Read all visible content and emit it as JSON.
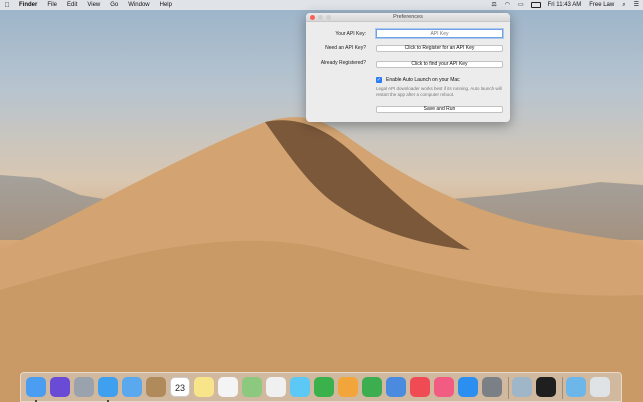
{
  "menubar": {
    "apple": "",
    "app": "Finder",
    "items": [
      "File",
      "Edit",
      "View",
      "Go",
      "Window",
      "Help"
    ],
    "clock": "Fri 11:43 AM",
    "user": "Free Law"
  },
  "window": {
    "title": "Preferences",
    "api_key_label": "Your API Key:",
    "api_key_value": "",
    "api_key_placeholder": "API Key",
    "need_key_label": "Need an API Key?",
    "register_button": "Click to Register for an API Key",
    "registered_label": "Already Registered?",
    "find_key_button": "Click to find your API Key",
    "auto_launch_label": "Enable Auto Launch on your Mac",
    "auto_launch_checked": true,
    "help_text": "Legal API downloader works best if its running. Auto launch will restart the app after a computer reboot.",
    "save_button": "Save and Run"
  },
  "dock": {
    "calendar_day": "23",
    "apps": [
      {
        "name": "finder-icon",
        "color": "#4a9df0"
      },
      {
        "name": "siri-icon",
        "color": "#6a4bd6"
      },
      {
        "name": "launchpad-icon",
        "color": "#9aa3ad"
      },
      {
        "name": "safari-icon",
        "color": "#3fa0f0"
      },
      {
        "name": "mail-icon",
        "color": "#5aa9ee"
      },
      {
        "name": "contacts-icon",
        "color": "#b08a5a"
      },
      {
        "name": "calendar-icon",
        "color": "#ffffff"
      },
      {
        "name": "notes-icon",
        "color": "#f8e58a"
      },
      {
        "name": "reminders-icon",
        "color": "#f4f4f4"
      },
      {
        "name": "maps-icon",
        "color": "#8cc97e"
      },
      {
        "name": "photos-icon",
        "color": "#f0f0f0"
      },
      {
        "name": "messages-icon",
        "color": "#5cc8f5"
      },
      {
        "name": "facetime-icon",
        "color": "#3ab14a"
      },
      {
        "name": "pages-icon",
        "color": "#f2a53a"
      },
      {
        "name": "numbers-icon",
        "color": "#3cae4f"
      },
      {
        "name": "keynote-icon",
        "color": "#4a8be0"
      },
      {
        "name": "news-icon",
        "color": "#f04a54"
      },
      {
        "name": "music-icon",
        "color": "#f25c82"
      },
      {
        "name": "app-store-icon",
        "color": "#2a8ff0"
      },
      {
        "name": "system-preferences-icon",
        "color": "#7b7f86"
      },
      {
        "name": "preview-icon",
        "color": "#9fb5c8"
      },
      {
        "name": "terminal-icon",
        "color": "#1f1f1f"
      },
      {
        "name": "downloads-folder-icon",
        "color": "#6cb6ea"
      },
      {
        "name": "trash-icon",
        "color": "#dfe3e6"
      }
    ]
  }
}
